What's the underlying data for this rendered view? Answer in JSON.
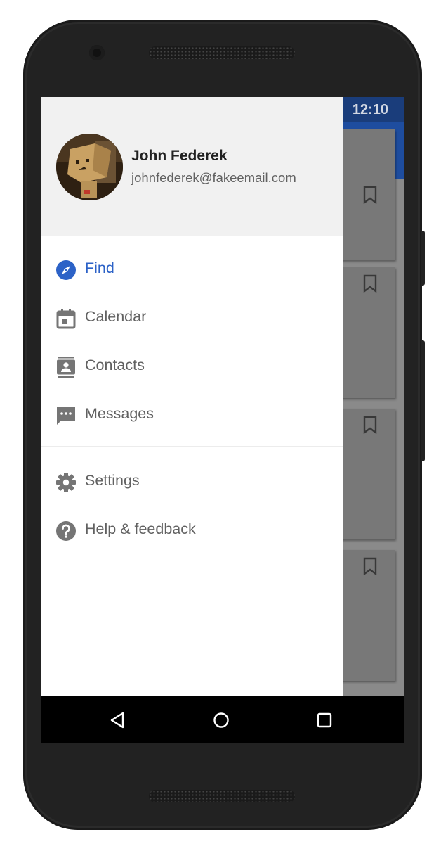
{
  "status_bar": {
    "time": "12:10"
  },
  "drawer": {
    "user": {
      "name": "John Federek",
      "email": "johnfederek@fakeemail.com"
    },
    "primary_items": [
      {
        "label": "Find",
        "icon": "compass-icon",
        "active": true
      },
      {
        "label": "Calendar",
        "icon": "calendar-icon",
        "active": false
      },
      {
        "label": "Contacts",
        "icon": "contacts-icon",
        "active": false
      },
      {
        "label": "Messages",
        "icon": "message-icon",
        "active": false
      }
    ],
    "secondary_items": [
      {
        "label": "Settings",
        "icon": "gear-icon"
      },
      {
        "label": "Help & feedback",
        "icon": "help-icon"
      }
    ]
  },
  "colors": {
    "accent": "#2c62c7",
    "app_bar": "#1f4fa3",
    "status_bar": "#1b3f7e",
    "drawer_header": "#f1f1f1"
  }
}
